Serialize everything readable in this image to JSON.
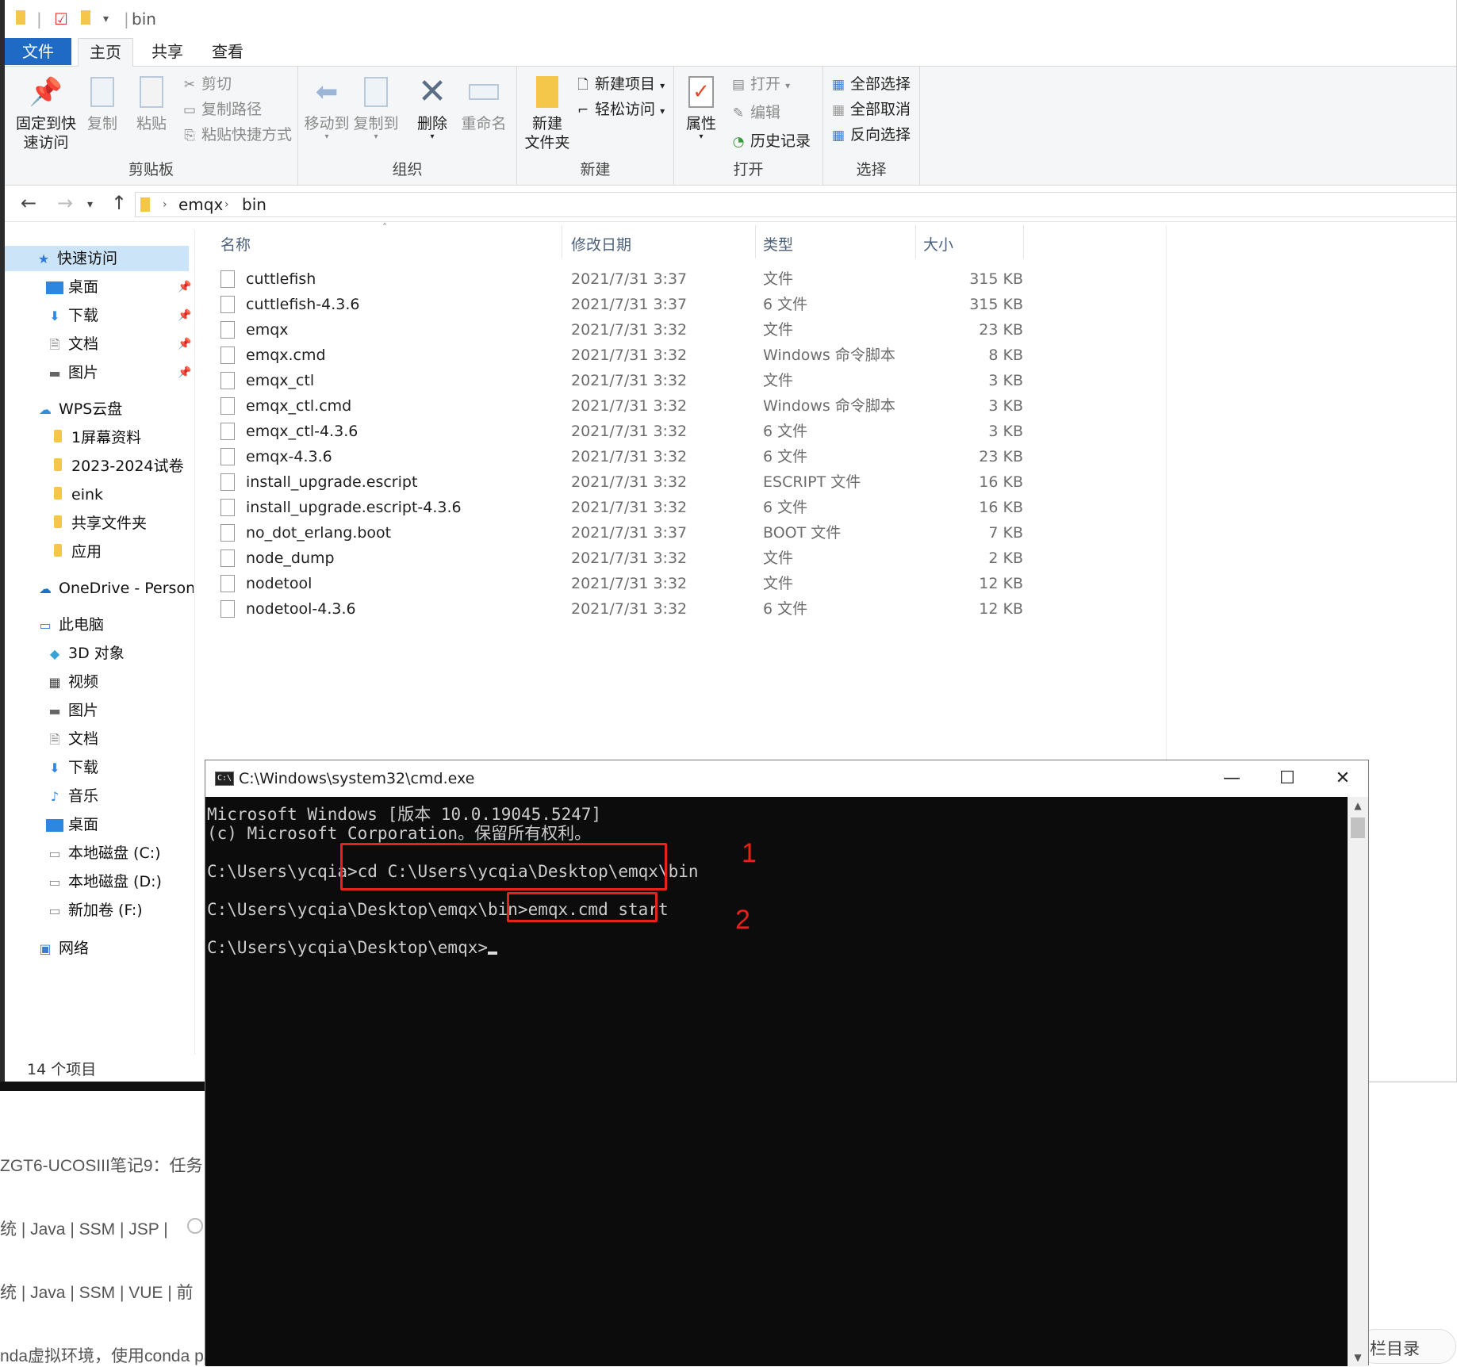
{
  "explorer": {
    "title": "bin",
    "tabs": [
      "文件",
      "主页",
      "共享",
      "查看"
    ],
    "ribbon": {
      "clipboard": {
        "label": "剪贴板",
        "pin": "固定到快\n速访问",
        "pin_l1": "固定到快",
        "pin_l2": "速访问",
        "copy": "复制",
        "paste": "粘贴",
        "cut": "剪切",
        "copy_path": "复制路径",
        "paste_shortcut": "粘贴快捷方式"
      },
      "organize": {
        "label": "组织",
        "move_to": "移动到",
        "copy_to": "复制到",
        "delete": "删除",
        "rename": "重命名"
      },
      "new": {
        "label": "新建",
        "new_folder_l1": "新建",
        "new_folder_l2": "文件夹",
        "new_item": "新建项目",
        "easy_access": "轻松访问"
      },
      "open": {
        "label": "打开",
        "properties": "属性",
        "open": "打开",
        "edit": "编辑",
        "history": "历史记录"
      },
      "select": {
        "label": "选择",
        "select_all": "全部选择",
        "select_none": "全部取消",
        "invert": "反向选择"
      }
    },
    "address": {
      "part1": "emqx",
      "part2": "bin"
    },
    "sidebar": {
      "quick_access": "快速访问",
      "items_quick": [
        "桌面",
        "下载",
        "文档",
        "图片"
      ],
      "wps": "WPS云盘",
      "items_wps": [
        "1屏幕资料",
        "2023-2024试卷",
        "eink",
        "共享文件夹",
        "应用"
      ],
      "onedrive": "OneDrive - Personal",
      "this_pc": "此电脑",
      "items_pc": [
        "3D 对象",
        "视频",
        "图片",
        "文档",
        "下载",
        "音乐",
        "桌面",
        "本地磁盘 (C:)",
        "本地磁盘 (D:)",
        "新加卷 (F:)"
      ],
      "network": "网络"
    },
    "columns": {
      "name": "名称",
      "date": "修改日期",
      "type": "类型",
      "size": "大小"
    },
    "files": [
      {
        "name": "cuttlefish",
        "date": "2021/7/31 3:37",
        "type": "文件",
        "size": "315 KB"
      },
      {
        "name": "cuttlefish-4.3.6",
        "date": "2021/7/31 3:37",
        "type": "6 文件",
        "size": "315 KB"
      },
      {
        "name": "emqx",
        "date": "2021/7/31 3:32",
        "type": "文件",
        "size": "23 KB"
      },
      {
        "name": "emqx.cmd",
        "date": "2021/7/31 3:32",
        "type": "Windows 命令脚本",
        "size": "8 KB"
      },
      {
        "name": "emqx_ctl",
        "date": "2021/7/31 3:32",
        "type": "文件",
        "size": "3 KB"
      },
      {
        "name": "emqx_ctl.cmd",
        "date": "2021/7/31 3:32",
        "type": "Windows 命令脚本",
        "size": "3 KB"
      },
      {
        "name": "emqx_ctl-4.3.6",
        "date": "2021/7/31 3:32",
        "type": "6 文件",
        "size": "3 KB"
      },
      {
        "name": "emqx-4.3.6",
        "date": "2021/7/31 3:32",
        "type": "6 文件",
        "size": "23 KB"
      },
      {
        "name": "install_upgrade.escript",
        "date": "2021/7/31 3:32",
        "type": "ESCRIPT 文件",
        "size": "16 KB"
      },
      {
        "name": "install_upgrade.escript-4.3.6",
        "date": "2021/7/31 3:32",
        "type": "6 文件",
        "size": "16 KB"
      },
      {
        "name": "no_dot_erlang.boot",
        "date": "2021/7/31 3:37",
        "type": "BOOT 文件",
        "size": "7 KB"
      },
      {
        "name": "node_dump",
        "date": "2021/7/31 3:32",
        "type": "文件",
        "size": "2 KB"
      },
      {
        "name": "nodetool",
        "date": "2021/7/31 3:32",
        "type": "文件",
        "size": "12 KB"
      },
      {
        "name": "nodetool-4.3.6",
        "date": "2021/7/31 3:32",
        "type": "6 文件",
        "size": "12 KB"
      }
    ],
    "status": "14 个项目"
  },
  "background_page": {
    "line1": "ZGT6-UCOSIII笔记9：任务",
    "line2": "统 | Java | SSM | JSP |",
    "line3": "统 | Java | SSM | VUE |  前",
    "line4": "nda虚拟环境，使用conda pa",
    "toc_button": "栏目录"
  },
  "cmd": {
    "title": "C:\\Windows\\system32\\cmd.exe",
    "lines": {
      "l1": "Microsoft Windows [版本 10.0.19045.5247]",
      "l2": "(c) Microsoft Corporation。保留所有权利。",
      "p1": "C:\\Users\\ycqia>",
      "c1": "cd C:\\Users\\ycqia\\Desktop\\emqx\\bin",
      "p2": "C:\\Users\\ycqia\\Desktop\\emqx\\bin>",
      "c2": "emqx.cmd start",
      "p3": "C:\\Users\\ycqia\\Desktop\\emqx>"
    },
    "annotation_1": "1",
    "annotation_2": "2",
    "annotation_color": "#e8221a"
  }
}
